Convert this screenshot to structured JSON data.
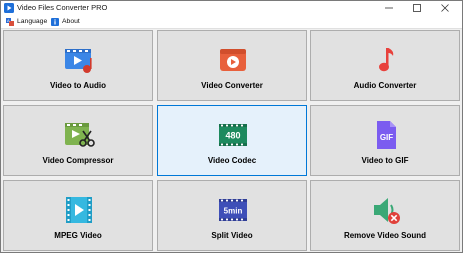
{
  "window": {
    "title": "Video Files Converter PRO"
  },
  "menu": {
    "language": "Language",
    "about": "About"
  },
  "tiles": [
    {
      "label": "Video to Audio"
    },
    {
      "label": "Video Converter"
    },
    {
      "label": "Audio Converter"
    },
    {
      "label": "Video Compressor"
    },
    {
      "label": "Video Codec",
      "icon_text": "480",
      "selected": true
    },
    {
      "label": "Video to GIF",
      "icon_text": "GIF"
    },
    {
      "label": "MPEG Video"
    },
    {
      "label": "Split Video",
      "icon_text": "5min"
    },
    {
      "label": "Remove Video Sound"
    }
  ],
  "colors": {
    "selected_border": "#0078d7",
    "selected_bg": "#e5f1fb",
    "tile_bg": "#e1e1e1"
  }
}
